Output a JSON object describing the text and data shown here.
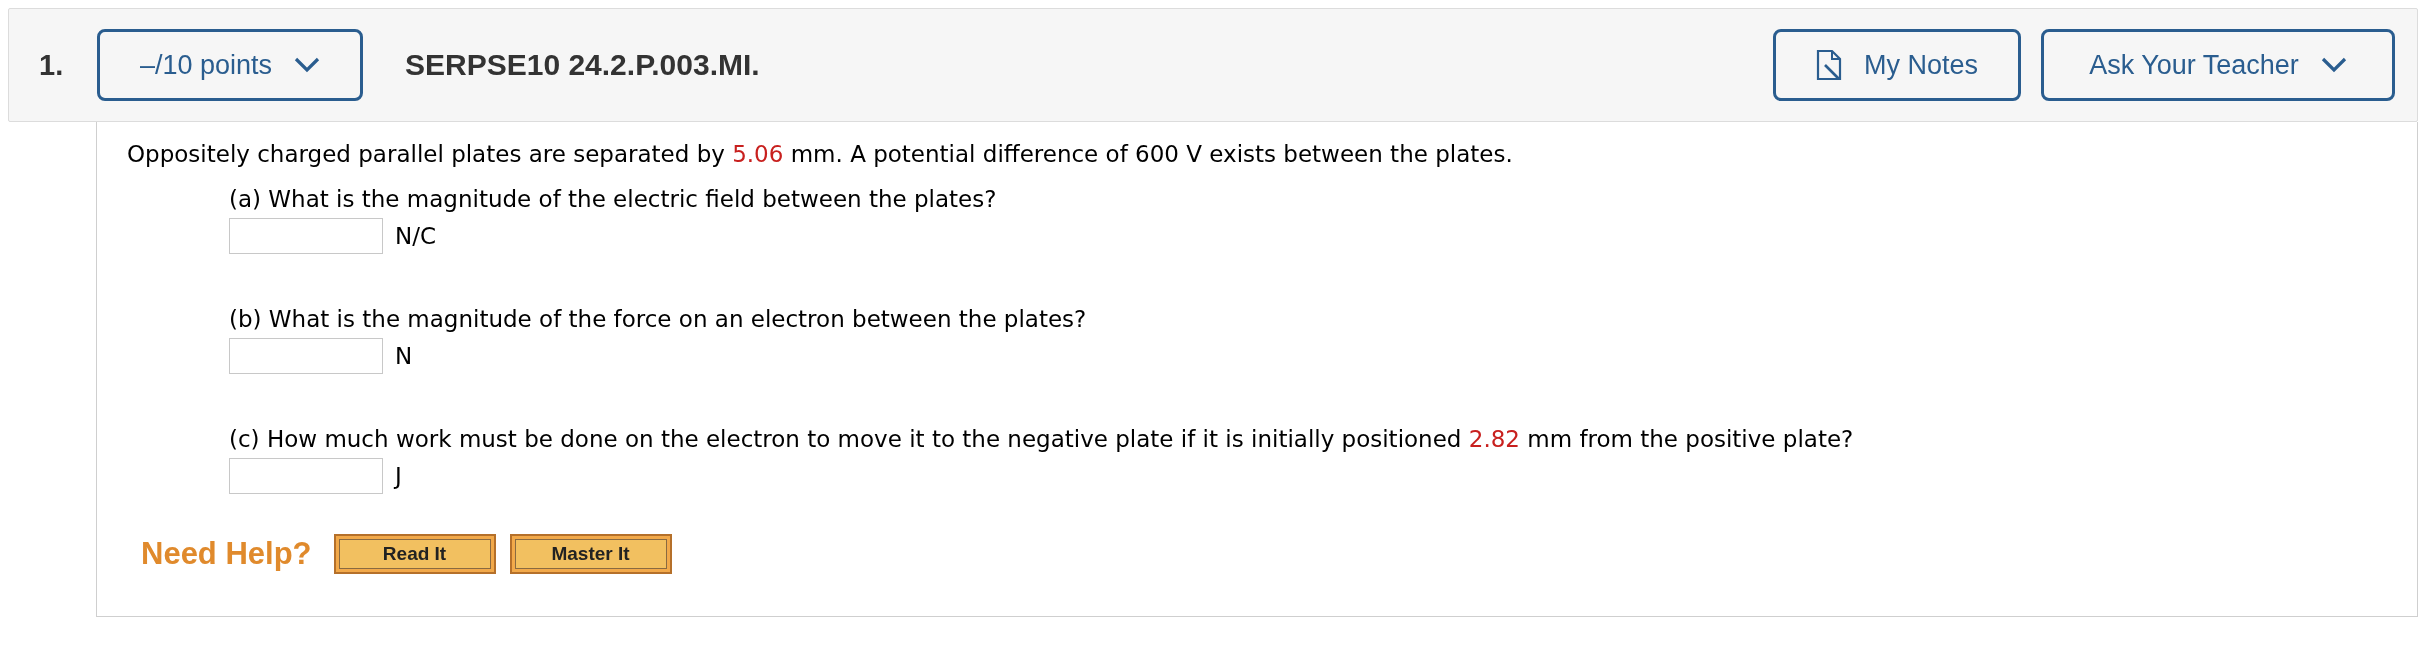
{
  "question": {
    "number": "1.",
    "points": "–/10 points",
    "code": "SERPSE10 24.2.P.003.MI.",
    "buttons": [
      {
        "kind": "notes",
        "label": "My Notes"
      },
      {
        "kind": "dropdown",
        "label": "Ask Your Teacher"
      }
    ]
  },
  "intro": [
    {
      "kind": "text",
      "text": "Oppositely charged parallel plates are separated by "
    },
    {
      "kind": "value",
      "text": "5.06"
    },
    {
      "kind": "text",
      "text": " mm. A potential difference of 600 V exists between the plates."
    }
  ],
  "parts": [
    {
      "prompt": [
        {
          "kind": "text",
          "text": "(a) What is the magnitude of the electric field between the plates?"
        }
      ],
      "unit": "N/C"
    },
    {
      "prompt": [
        {
          "kind": "text",
          "text": "(b) What is the magnitude of the force on an electron between the plates?"
        }
      ],
      "unit": "N"
    },
    {
      "prompt": [
        {
          "kind": "text",
          "text": "(c) How much work must be done on the electron to move it to the negative plate if it is initially positioned "
        },
        {
          "kind": "value",
          "text": "2.82"
        },
        {
          "kind": "text",
          "text": " mm from the positive plate?"
        }
      ],
      "unit": "J"
    }
  ],
  "help": {
    "label": "Need Help?",
    "buttons": [
      "Read It",
      "Master It"
    ]
  }
}
